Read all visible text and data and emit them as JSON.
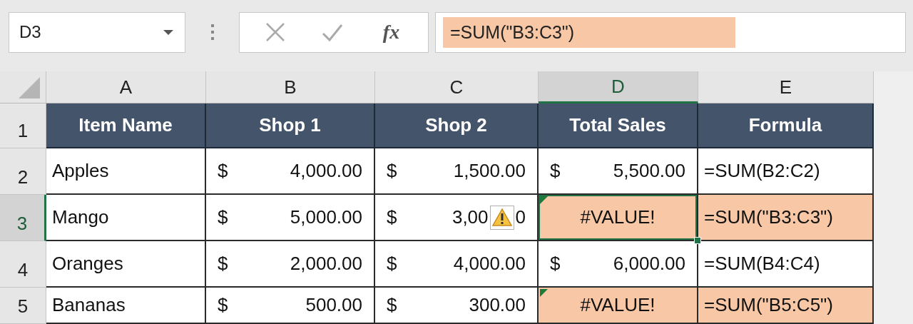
{
  "name_box": {
    "value": "D3"
  },
  "formula_bar": {
    "function_label": "fx",
    "value": "=SUM(\"B3:C3\")",
    "highlighted": true
  },
  "columns": [
    {
      "label": "A",
      "selected": false
    },
    {
      "label": "B",
      "selected": false
    },
    {
      "label": "C",
      "selected": false
    },
    {
      "label": "D",
      "selected": true
    },
    {
      "label": "E",
      "selected": false
    }
  ],
  "rows": [
    {
      "number": "1",
      "selected": false,
      "cells": [
        {
          "kind": "header",
          "text": "Item Name"
        },
        {
          "kind": "header",
          "text": "Shop 1"
        },
        {
          "kind": "header",
          "text": "Shop 2"
        },
        {
          "kind": "header",
          "text": "Total Sales"
        },
        {
          "kind": "header",
          "text": "Formula"
        }
      ]
    },
    {
      "number": "2",
      "selected": false,
      "cells": [
        {
          "kind": "text",
          "text": "Apples",
          "highlighted": false,
          "flagged": false,
          "selected": false
        },
        {
          "kind": "currency",
          "symbol": "$",
          "amount": "4,000.00",
          "highlighted": false,
          "flagged": false,
          "selected": false
        },
        {
          "kind": "currency",
          "symbol": "$",
          "amount": "1,500.00",
          "highlighted": false,
          "flagged": false,
          "selected": false
        },
        {
          "kind": "currency",
          "symbol": "$",
          "amount": "5,500.00",
          "highlighted": false,
          "flagged": false,
          "selected": false
        },
        {
          "kind": "text",
          "text": "=SUM(B2:C2)",
          "highlighted": false,
          "flagged": false,
          "selected": false
        }
      ]
    },
    {
      "number": "3",
      "selected": true,
      "cells": [
        {
          "kind": "text",
          "text": "Mango",
          "highlighted": false,
          "flagged": false,
          "selected": false
        },
        {
          "kind": "currency",
          "symbol": "$",
          "amount": "5,000.00",
          "highlighted": false,
          "flagged": false,
          "selected": false
        },
        {
          "kind": "currency-warning",
          "symbol": "$",
          "amount": "3,00",
          "amount_tail": "0",
          "highlighted": false,
          "flagged": false,
          "selected": false
        },
        {
          "kind": "error",
          "text": "#VALUE!",
          "highlighted": true,
          "flagged": true,
          "selected": true
        },
        {
          "kind": "text",
          "text": "=SUM(\"B3:C3\")",
          "highlighted": true,
          "flagged": false,
          "selected": false
        }
      ]
    },
    {
      "number": "4",
      "selected": false,
      "cells": [
        {
          "kind": "text",
          "text": "Oranges",
          "highlighted": false,
          "flagged": false,
          "selected": false
        },
        {
          "kind": "currency",
          "symbol": "$",
          "amount": "2,000.00",
          "highlighted": false,
          "flagged": false,
          "selected": false
        },
        {
          "kind": "currency",
          "symbol": "$",
          "amount": "4,000.00",
          "highlighted": false,
          "flagged": false,
          "selected": false
        },
        {
          "kind": "currency",
          "symbol": "$",
          "amount": "6,000.00",
          "highlighted": false,
          "flagged": false,
          "selected": false
        },
        {
          "kind": "text",
          "text": "=SUM(B4:C4)",
          "highlighted": false,
          "flagged": false,
          "selected": false
        }
      ]
    },
    {
      "number": "5",
      "selected": false,
      "cells": [
        {
          "kind": "text",
          "text": "Bananas",
          "highlighted": false,
          "flagged": false,
          "selected": false
        },
        {
          "kind": "currency",
          "symbol": "$",
          "amount": "500.00",
          "highlighted": false,
          "flagged": false,
          "selected": false
        },
        {
          "kind": "currency",
          "symbol": "$",
          "amount": "300.00",
          "highlighted": false,
          "flagged": false,
          "selected": false
        },
        {
          "kind": "error",
          "text": "#VALUE!",
          "highlighted": true,
          "flagged": true,
          "selected": false
        },
        {
          "kind": "text",
          "text": "=SUM(\"B5:C5\")",
          "highlighted": true,
          "flagged": false,
          "selected": false
        }
      ]
    }
  ]
}
